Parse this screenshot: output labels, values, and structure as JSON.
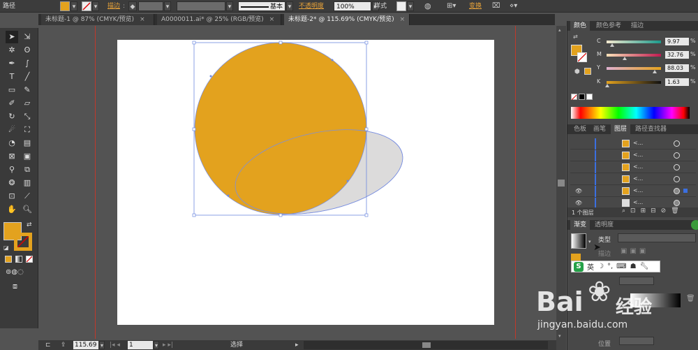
{
  "control_bar": {
    "object_type": "路径",
    "stroke_label": "描边",
    "stroke_profile": "基本",
    "opacity_label": "不透明度",
    "opacity_value": "100%",
    "style_label": "样式",
    "transform_label": "变换",
    "fill_color": "#E3A21E"
  },
  "tabs": [
    {
      "label": "未标题-1 @ 87% (CMYK/预览)",
      "close": "×"
    },
    {
      "label": "A0000011.ai* @ 25% (RGB/预览)",
      "close": "×"
    },
    {
      "label": "未标题-2* @ 115.69% (CMYK/预览)",
      "close": "×"
    }
  ],
  "canvas": {
    "circle_color": "#E3A21E",
    "ellipse_color": "#DCDBDB",
    "selection_color": "#6f8ae0"
  },
  "status_bar": {
    "zoom": "115.69",
    "artboard": "1",
    "tool": "选择"
  },
  "color_panel": {
    "tabs": [
      "颜色",
      "颜色参考",
      "描边"
    ],
    "channels": [
      {
        "label": "C",
        "value": "9.97",
        "unit": "%",
        "level": 0.0997
      },
      {
        "label": "M",
        "value": "32.76",
        "unit": "%",
        "level": 0.3276
      },
      {
        "label": "Y",
        "value": "88.03",
        "unit": "%",
        "level": 0.8803
      },
      {
        "label": "K",
        "value": "1.63",
        "unit": "%",
        "level": 0.0163
      }
    ]
  },
  "layers_panel": {
    "tabs": [
      "色板",
      "画笔",
      "图层",
      "路径查找器"
    ],
    "rows": [
      "<...",
      "<...",
      "<...",
      "<...",
      "<...",
      "<..."
    ],
    "footer": "1 个图层"
  },
  "gradient_panel": {
    "tabs": [
      "渐变",
      "透明度"
    ],
    "type_label": "类型",
    "stroke_label": "描边",
    "position_label": "位置"
  },
  "ime": {
    "logo": "S",
    "lang": "英"
  },
  "watermark": {
    "brand": "Bai",
    "brand2": "经验",
    "url": "jingyan.baidu.com"
  }
}
